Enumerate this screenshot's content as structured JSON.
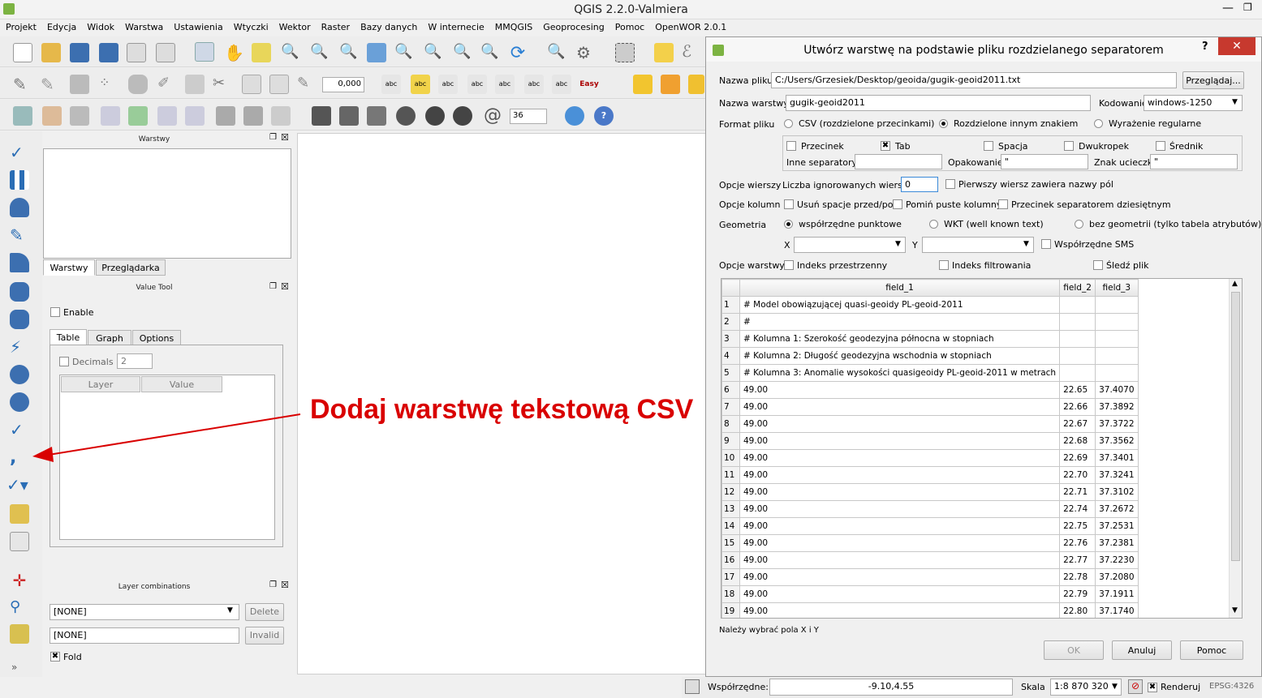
{
  "window": {
    "title": "QGIS 2.2.0-Valmiera"
  },
  "menu": [
    "Projekt",
    "Edycja",
    "Widok",
    "Warstwa",
    "Ustawienia",
    "Wtyczki",
    "Wektor",
    "Raster",
    "Bazy danych",
    "W internecie",
    "MMQGIS",
    "Geoprocesing",
    "Pomoc",
    "OpenWOR 2.0.1"
  ],
  "toolbar": {
    "scale_value": "0,000",
    "rotation_value": "36",
    "easy_label": "Easy"
  },
  "layers_panel": {
    "title": "Warstwy",
    "tabs": [
      "Warstwy",
      "Przeglądarka"
    ]
  },
  "value_tool": {
    "title": "Value Tool",
    "enable_label": "Enable",
    "tabs": [
      "Table",
      "Graph",
      "Options"
    ],
    "decimals_label": "Decimals",
    "decimals_value": "2",
    "columns": [
      "Layer",
      "Value"
    ]
  },
  "layer_combinations": {
    "title": "Layer combinations",
    "combo_value": "[NONE]",
    "delete_label": "Delete",
    "input_value": "[NONE]",
    "invalid_label": "Invalid",
    "fold_label": "Fold"
  },
  "annotation": {
    "text": "Dodaj warstwę tekstową CSV",
    "color": "#d90000"
  },
  "dialog": {
    "title": "Utwórz warstwę na podstawie pliku rozdzielanego separatorem",
    "help_mark": "?",
    "file_label": "Nazwa pliku",
    "file_value": "C:/Users/Grzesiek/Desktop/geoida/gugik-geoid2011.txt",
    "browse_label": "Przeglądaj...",
    "layer_label": "Nazwa warstwy",
    "layer_value": "gugik-geoid2011",
    "encoding_label": "Kodowanie",
    "encoding_value": "windows-1250",
    "format_label": "Format pliku",
    "format_csv": "CSV (rozdzielone przecinkami)",
    "format_custom": "Rozdzielone innym znakiem",
    "format_regex": "Wyrażenie regularne",
    "sep_comma": "Przecinek",
    "sep_tab": "Tab",
    "sep_space": "Spacja",
    "sep_colon": "Dwukropek",
    "sep_semicolon": "Średnik",
    "other_sep_label": "Inne separatory",
    "quote_label": "Opakowanie",
    "quote_value": "\"",
    "escape_label": "Znak ucieczki",
    "escape_value": "\"",
    "row_opts_label": "Opcje wierszy",
    "skip_label": "Liczba ignorowanych wierszy",
    "skip_value": "0",
    "header_label": "Pierwszy wiersz zawiera nazwy pól",
    "col_opts_label": "Opcje kolumn",
    "trim_label": "Usuń spacje przed/po",
    "discard_label": "Pomiń puste kolumny",
    "decimal_label": "Przecinek separatorem dziesiętnym",
    "geometry_label": "Geometria",
    "geom_point": "współrzędne punktowe",
    "geom_wkt": "WKT (well known text)",
    "geom_none": "bez geometrii (tylko tabela atrybutów)",
    "x_label": "X",
    "y_label": "Y",
    "dms_label": "Współrzędne SMS",
    "layer_opts_label": "Opcje warstwy",
    "spatial_index": "Indeks przestrzenny",
    "subset_index": "Indeks filtrowania",
    "watch_file": "Śledź plik",
    "columns": [
      "field_1",
      "field_2",
      "field_3"
    ],
    "rows": [
      [
        "1",
        "# Model obowiązującej quasi-geoidy PL-geoid-2011",
        "",
        ""
      ],
      [
        "2",
        "#",
        "",
        ""
      ],
      [
        "3",
        "# Kolumna 1: Szerokość geodezyjna północna w stopniach",
        "",
        ""
      ],
      [
        "4",
        "# Kolumna 2: Długość geodezyjna wschodnia w stopniach",
        "",
        ""
      ],
      [
        "5",
        "# Kolumna 3: Anomalie wysokości quasigeoidy PL-geoid-2011 w metrach",
        "",
        ""
      ],
      [
        "6",
        "49.00",
        "22.65",
        "37.4070"
      ],
      [
        "7",
        "49.00",
        "22.66",
        "37.3892"
      ],
      [
        "8",
        "49.00",
        "22.67",
        "37.3722"
      ],
      [
        "9",
        "49.00",
        "22.68",
        "37.3562"
      ],
      [
        "10",
        "49.00",
        "22.69",
        "37.3401"
      ],
      [
        "11",
        "49.00",
        "22.70",
        "37.3241"
      ],
      [
        "12",
        "49.00",
        "22.71",
        "37.3102"
      ],
      [
        "13",
        "49.00",
        "22.74",
        "37.2672"
      ],
      [
        "14",
        "49.00",
        "22.75",
        "37.2531"
      ],
      [
        "15",
        "49.00",
        "22.76",
        "37.2381"
      ],
      [
        "16",
        "49.00",
        "22.77",
        "37.2230"
      ],
      [
        "17",
        "49.00",
        "22.78",
        "37.2080"
      ],
      [
        "18",
        "49.00",
        "22.79",
        "37.1911"
      ],
      [
        "19",
        "49.00",
        "22.80",
        "37.1740"
      ]
    ],
    "status_msg": "Należy wybrać pola X i Y",
    "ok_label": "OK",
    "cancel_label": "Anuluj",
    "help_label": "Pomoc"
  },
  "statusbar": {
    "coords_label": "Współrzędne:",
    "coords_value": "-9.10,4.55",
    "scale_label": "Skala",
    "scale_value": "1:8 870 320",
    "render_label": "Renderuj",
    "epsg": "EPSG:4326"
  }
}
